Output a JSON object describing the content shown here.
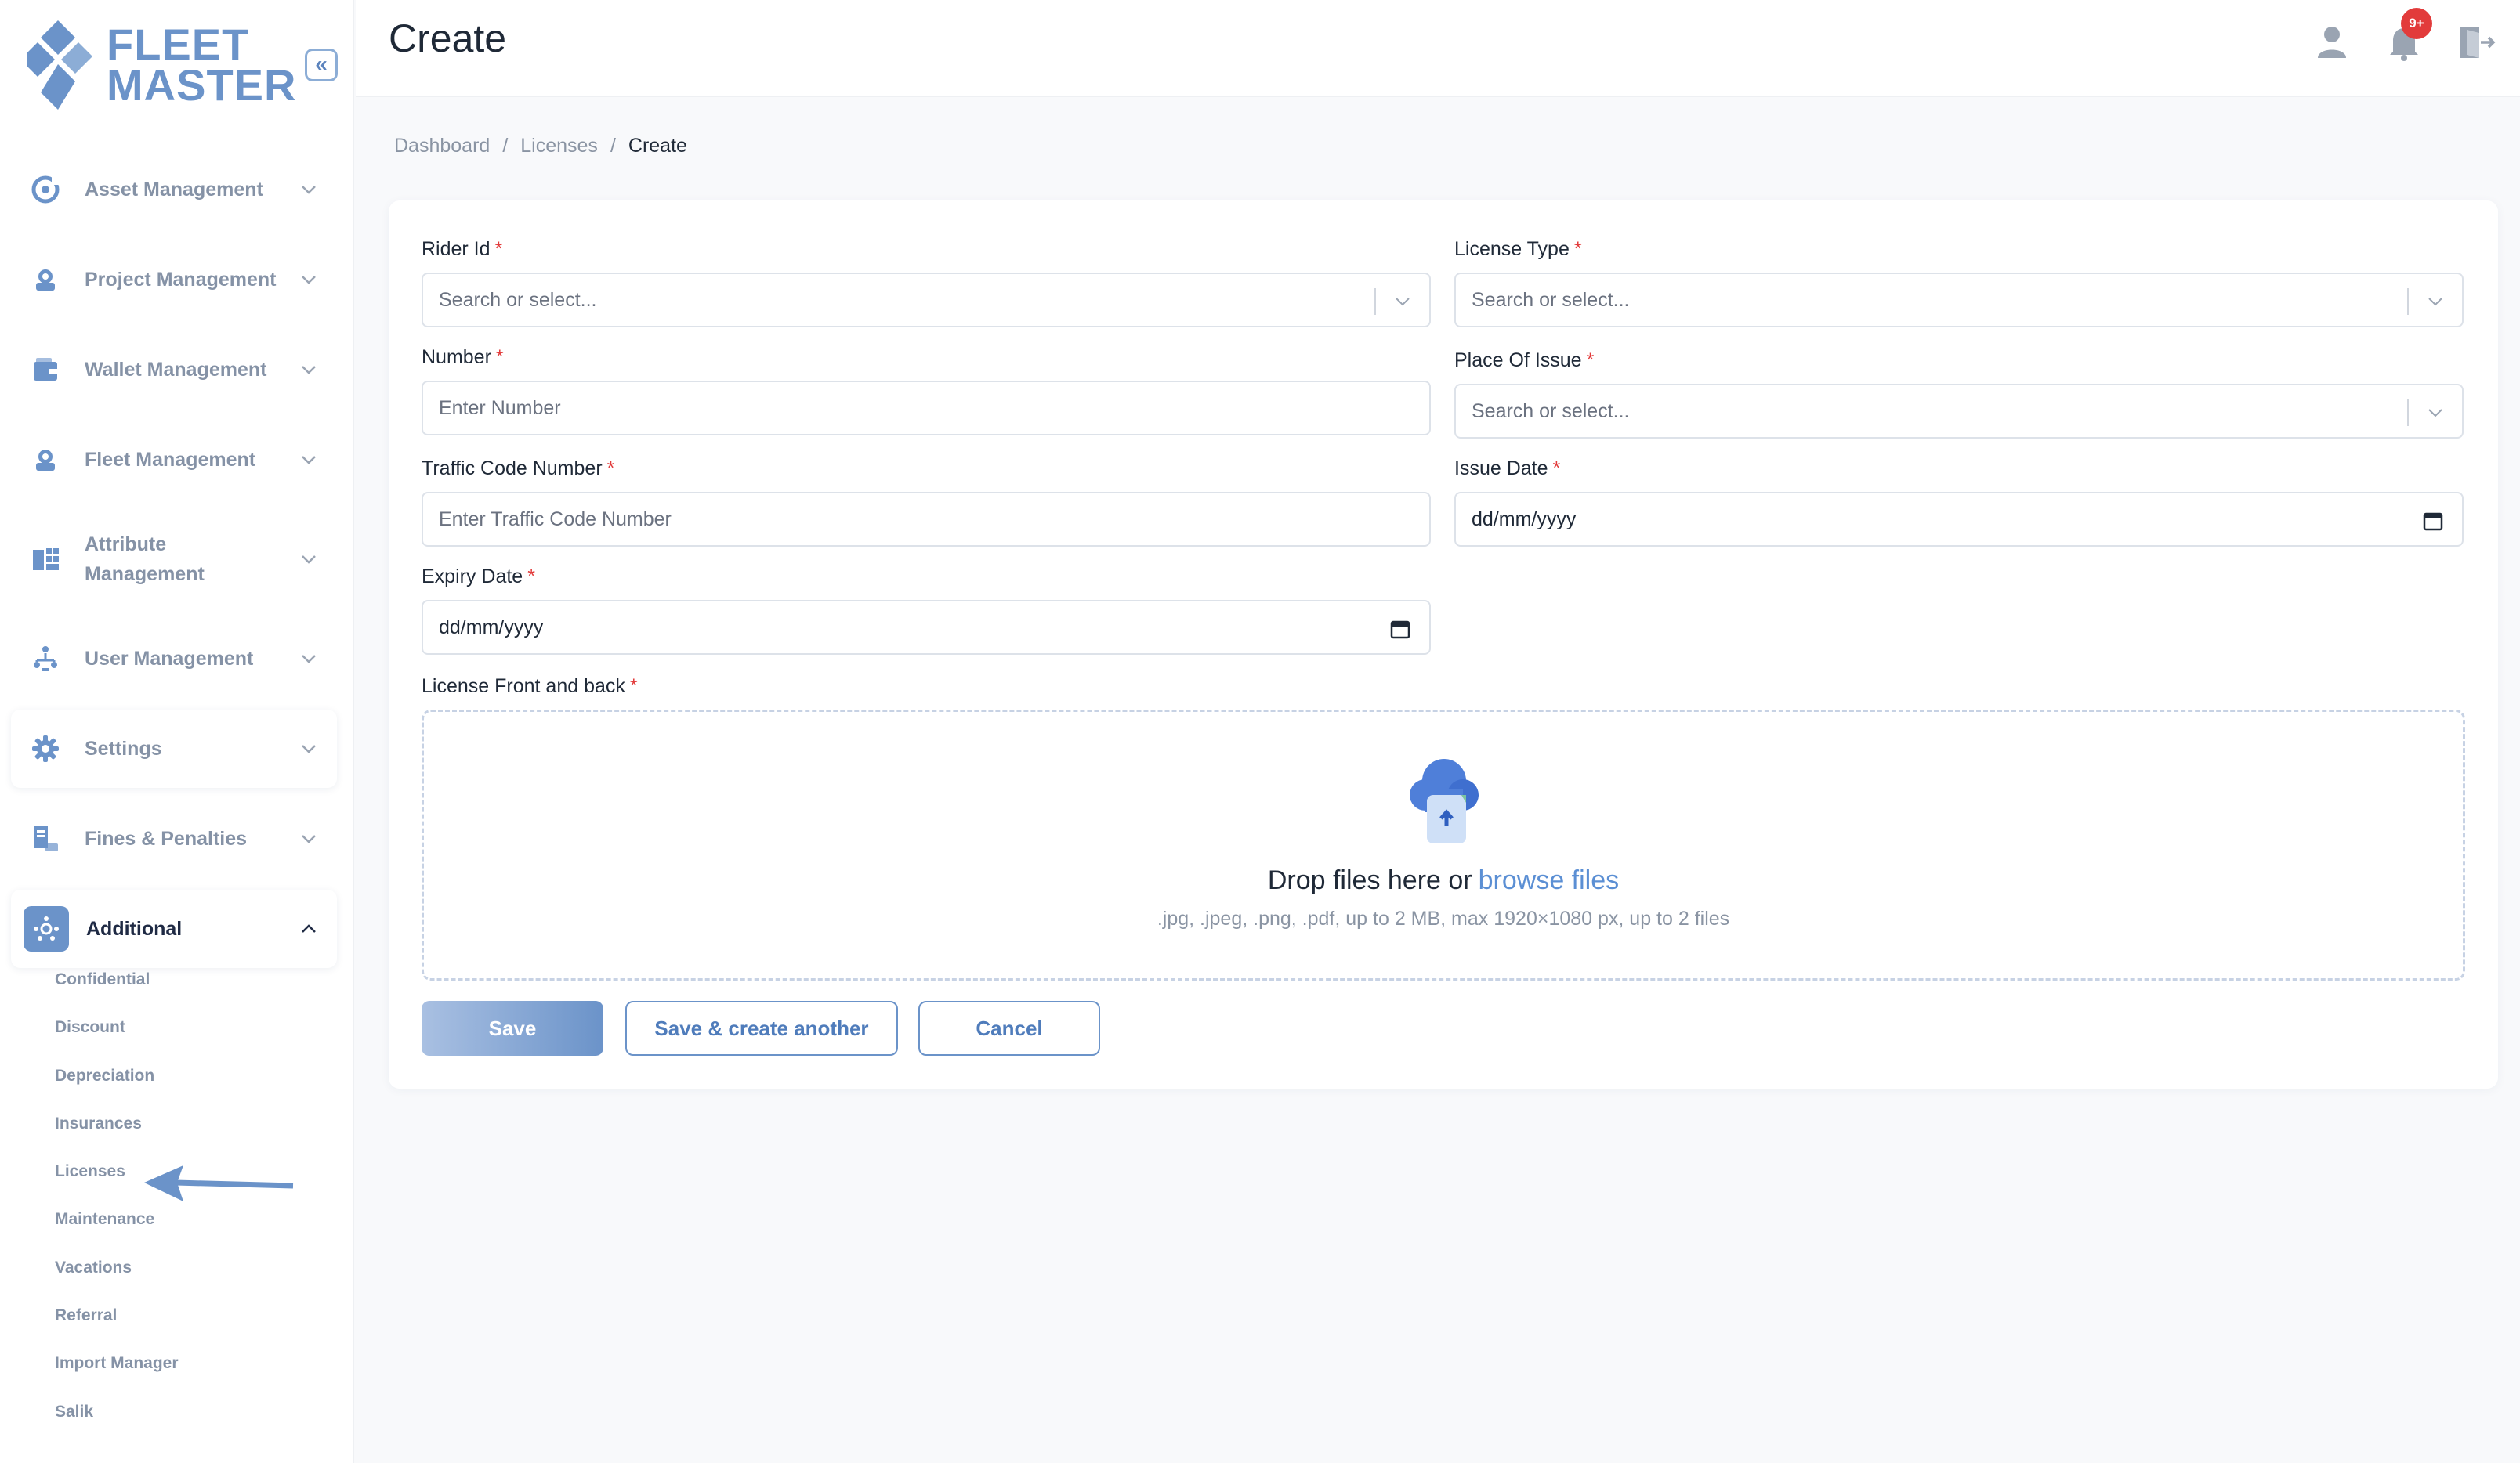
{
  "brand": {
    "line1": "FLEET",
    "line2": "MASTER",
    "accent": "#6b93c9"
  },
  "sidebar": {
    "collapse_glyph": "«",
    "items": [
      {
        "label": "Asset Management",
        "icon": "asset-icon"
      },
      {
        "label": "Project Management",
        "icon": "project-icon"
      },
      {
        "label": "Wallet Management",
        "icon": "wallet-icon"
      },
      {
        "label": "Fleet Management",
        "icon": "fleet-icon"
      },
      {
        "label": "Attribute Management",
        "icon": "attribute-icon"
      },
      {
        "label": "User Management",
        "icon": "users-icon"
      },
      {
        "label": "Settings",
        "icon": "gear-icon"
      },
      {
        "label": "Fines & Penalties",
        "icon": "fines-icon"
      },
      {
        "label": "Additional",
        "icon": "additional-icon"
      }
    ],
    "sub_items": [
      "Confidential",
      "Discount",
      "Depreciation",
      "Insurances",
      "Licenses",
      "Maintenance",
      "Vacations",
      "Referral",
      "Import Manager",
      "Salik"
    ]
  },
  "header": {
    "title": "Create",
    "notification_count": "9+"
  },
  "breadcrumb": [
    "Dashboard",
    "/",
    "Licenses",
    "/",
    "Create"
  ],
  "form": {
    "rider_id": {
      "label": "Rider Id",
      "placeholder": "Search or select..."
    },
    "license_type": {
      "label": "License Type",
      "placeholder": "Search or select..."
    },
    "number": {
      "label": "Number",
      "placeholder": "Enter Number"
    },
    "place_of_issue": {
      "label": "Place Of Issue",
      "placeholder": "Search or select..."
    },
    "traffic_code": {
      "label": "Traffic Code Number",
      "placeholder": "Enter Traffic Code Number"
    },
    "issue_date": {
      "label": "Issue Date",
      "value": "dd/mm/yyyy"
    },
    "expiry_date": {
      "label": "Expiry Date",
      "value": "dd/mm/yyyy"
    },
    "upload": {
      "label": "License Front and back",
      "drop_text": "Drop files here or",
      "browse_text": "browse files",
      "hint": ".jpg, .jpeg, .png, .pdf, up to 2 MB, max 1920×1080 px, up to 2 files"
    },
    "required_mark": "*"
  },
  "buttons": {
    "save": "Save",
    "save_another": "Save & create another",
    "cancel": "Cancel"
  }
}
